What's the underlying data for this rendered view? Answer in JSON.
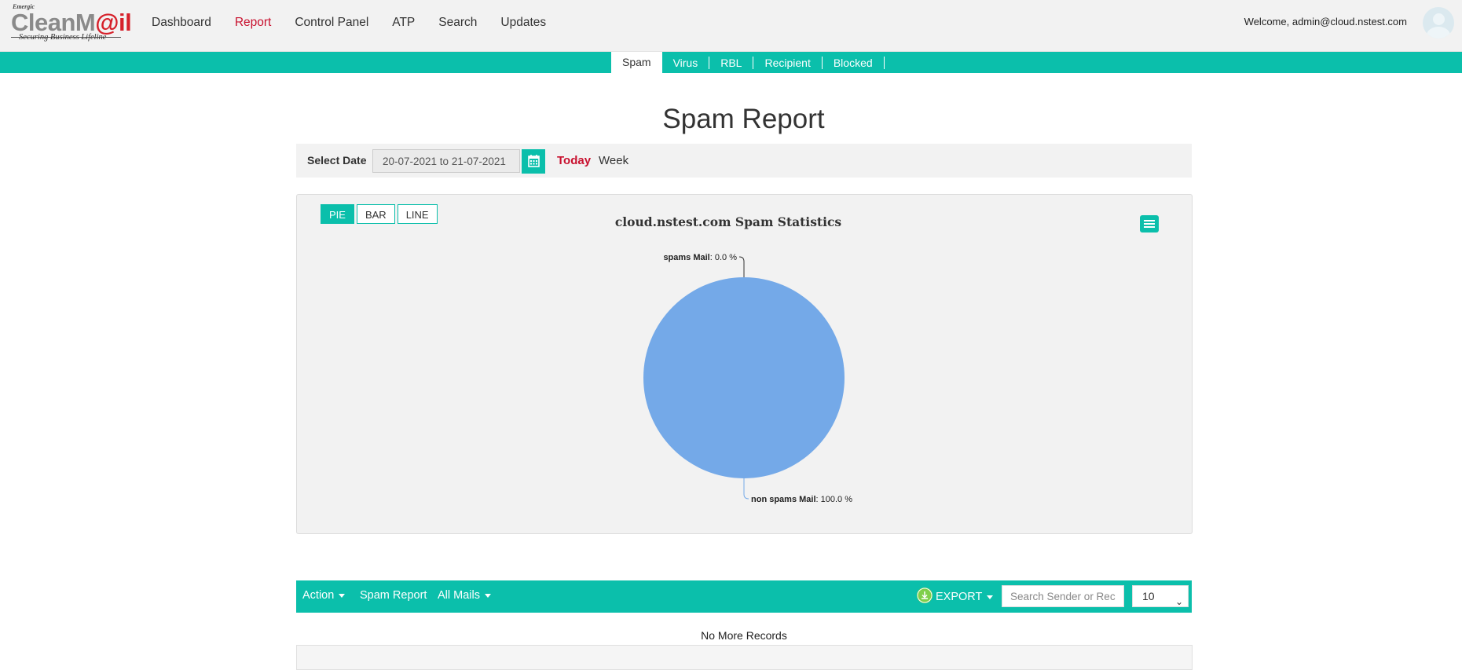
{
  "app": {
    "logo_small": "Emergic",
    "logo_brand_prefix": "CleanM",
    "logo_brand_suffix": "@il",
    "logo_tagline": "Securing Business Lifeline",
    "welcome": "Welcome, admin@cloud.nstest.com"
  },
  "nav": {
    "items": [
      {
        "label": "Dashboard",
        "active": false
      },
      {
        "label": "Report",
        "active": true
      },
      {
        "label": "Control Panel",
        "active": false
      },
      {
        "label": "ATP",
        "active": false
      },
      {
        "label": "Search",
        "active": false
      },
      {
        "label": "Updates",
        "active": false
      }
    ]
  },
  "subnav": {
    "tabs": [
      {
        "label": "Spam",
        "active": true
      },
      {
        "label": "Virus",
        "active": false
      },
      {
        "label": "RBL",
        "active": false
      },
      {
        "label": "Recipient",
        "active": false
      },
      {
        "label": "Blocked",
        "active": false
      }
    ]
  },
  "page": {
    "title": "Spam Report"
  },
  "datebar": {
    "label": "Select Date",
    "range_value": "20-07-2021 to 21-07-2021",
    "today_label": "Today",
    "week_label": "Week"
  },
  "chart_controls": {
    "types": [
      {
        "label": "PIE",
        "active": true
      },
      {
        "label": "BAR",
        "active": false
      },
      {
        "label": "LINE",
        "active": false
      }
    ]
  },
  "chart_data": {
    "type": "pie",
    "title": "cloud.nstest.com  Spam  Statistics",
    "slices": [
      {
        "name": "spams Mail",
        "value": 0.0,
        "label_value": "0.0 %"
      },
      {
        "name": "non spams Mail",
        "value": 100.0,
        "label_value": "100.0 %"
      }
    ],
    "color": "#74a9e8"
  },
  "table": {
    "action_label": "Action",
    "report_label": "Spam Report",
    "filter_label": "All Mails",
    "export_label": "EXPORT",
    "search_placeholder": "Search Sender or Rec",
    "per_page": "10",
    "empty_message": "No More Records"
  },
  "colors": {
    "accent": "#0bbfab",
    "active_text": "#c8102e",
    "pie_fill": "#74a9e8"
  }
}
